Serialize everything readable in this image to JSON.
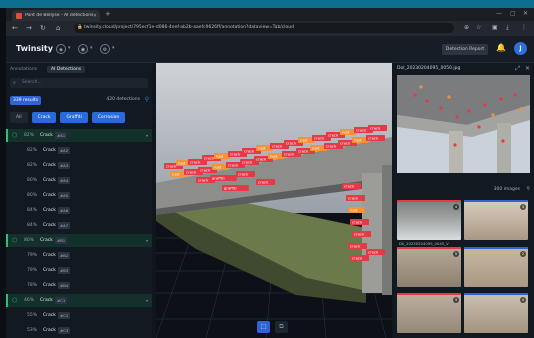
{
  "browser": {
    "tab_title": "Pont de Bellyse - AI detections",
    "url": "twinsity.cloud/project/795ecf1e-d086-4eef-ab2b-aaefc9626ff/annotation?dataview=Tab/cloud"
  },
  "app": {
    "logo": "Twinsity",
    "detection_report": "Detection Report",
    "avatar_initial": "J"
  },
  "left_panel": {
    "tabs": [
      "Annotations",
      "AI Detections"
    ],
    "search_placeholder": "Search...",
    "results": "339 results",
    "detections": "420 detections",
    "filters": [
      "All",
      "Crack",
      "Graffiti",
      "Corrosion"
    ],
    "rows": [
      {
        "group": true,
        "pct": "82%",
        "cls": "Crack",
        "chip": "#A1"
      },
      {
        "group": false,
        "pct": "82%",
        "cls": "Crack",
        "chip": "#A2"
      },
      {
        "group": false,
        "pct": "82%",
        "cls": "Crack",
        "chip": "#A3"
      },
      {
        "group": false,
        "pct": "80%",
        "cls": "Crack",
        "chip": "#A4"
      },
      {
        "group": false,
        "pct": "80%",
        "cls": "Crack",
        "chip": "#A5"
      },
      {
        "group": false,
        "pct": "84%",
        "cls": "Crack",
        "chip": "#A6"
      },
      {
        "group": false,
        "pct": "84%",
        "cls": "Crack",
        "chip": "#A7"
      },
      {
        "group": true,
        "pct": "80%",
        "cls": "Crack",
        "chip": "#B1"
      },
      {
        "group": false,
        "pct": "79%",
        "cls": "Crack",
        "chip": "#B2"
      },
      {
        "group": false,
        "pct": "79%",
        "cls": "Crack",
        "chip": "#B3"
      },
      {
        "group": false,
        "pct": "78%",
        "cls": "Crack",
        "chip": "#B4"
      },
      {
        "group": true,
        "pct": "46%",
        "cls": "Crack",
        "chip": "#C1"
      },
      {
        "group": false,
        "pct": "55%",
        "cls": "Crack",
        "chip": "#C2"
      },
      {
        "group": false,
        "pct": "53%",
        "cls": "Crack",
        "chip": "#C3"
      },
      {
        "group": false,
        "pct": "52%",
        "cls": "Crack",
        "chip": "#C4"
      }
    ]
  },
  "viewer": {
    "labels": [
      "crack",
      "rust",
      "graffiti"
    ]
  },
  "right_panel": {
    "title": "Dol_20230204095_0050.jpg",
    "image_count": "300 images",
    "thumb_caption": "DJI_20230204095_0045_V",
    "thumb_badges": [
      "4",
      "3",
      "5",
      "2",
      "3",
      "4",
      "2",
      "3"
    ]
  },
  "colors": {
    "accent": "#2f63d6",
    "group": "#2bbf7a",
    "crack_label": "#e53946",
    "rust_label": "#f2933a"
  }
}
